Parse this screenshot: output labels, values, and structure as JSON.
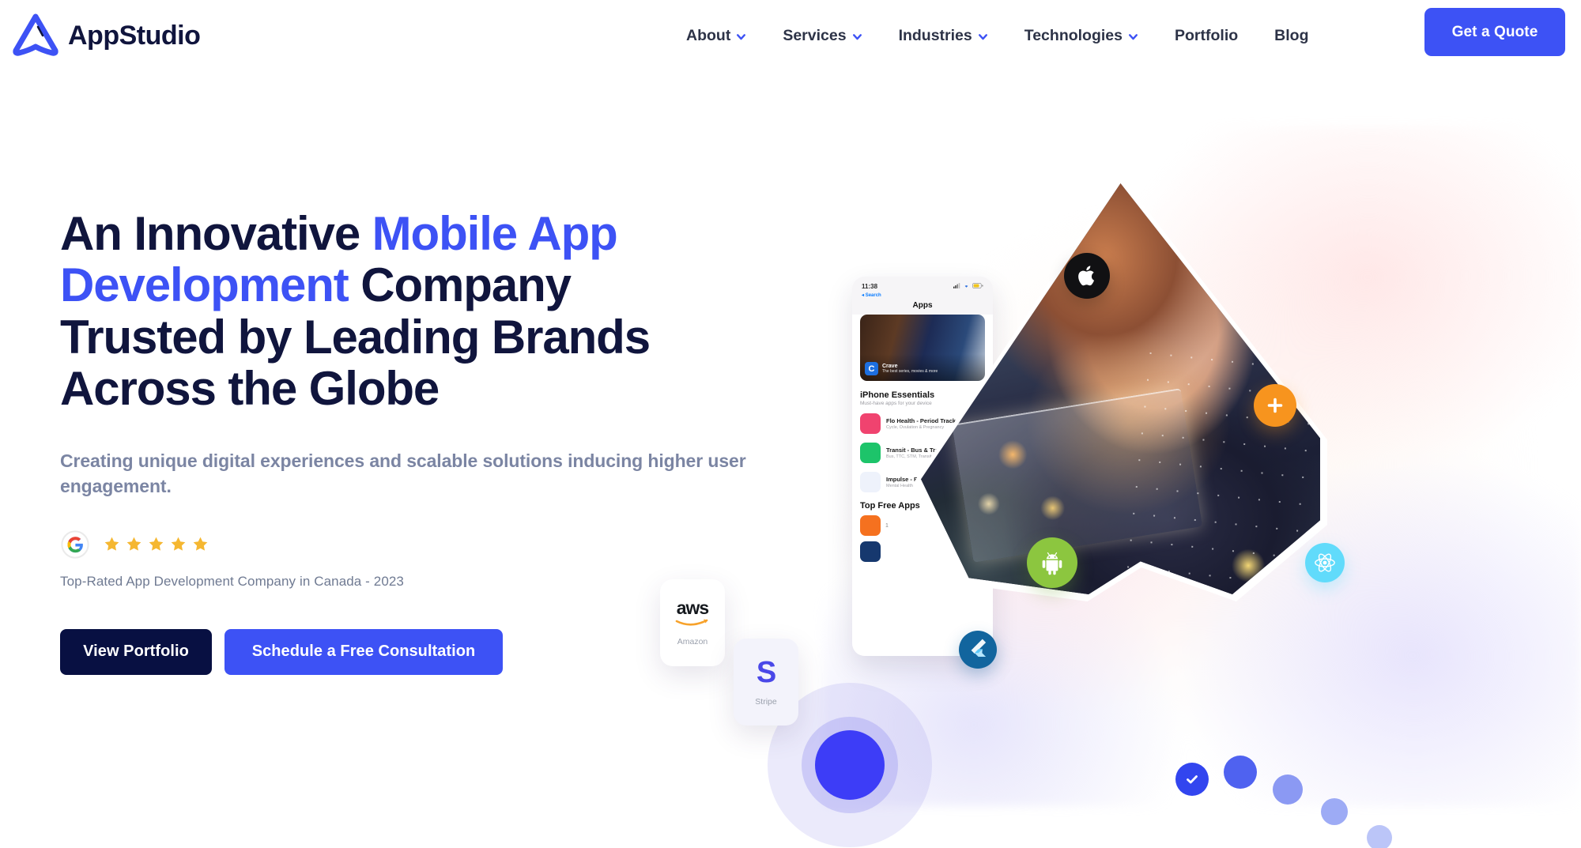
{
  "brand": {
    "name": "AppStudio",
    "logo_icon": "appstudio-triangle-logo",
    "accent_blue": "#3d52f5",
    "dark_navy": "#10153d"
  },
  "nav": {
    "items": [
      {
        "label": "About",
        "has_dropdown": true,
        "caret_icon": "chevron-down-icon"
      },
      {
        "label": "Services",
        "has_dropdown": true,
        "caret_icon": "chevron-down-icon"
      },
      {
        "label": "Industries",
        "has_dropdown": true,
        "caret_icon": "chevron-down-icon"
      },
      {
        "label": "Technologies",
        "has_dropdown": true,
        "caret_icon": "chevron-down-icon"
      },
      {
        "label": "Portfolio",
        "has_dropdown": false
      },
      {
        "label": "Blog",
        "has_dropdown": false
      }
    ],
    "cta_label": "Get a Quote"
  },
  "hero": {
    "headline_parts": [
      {
        "text": "An Innovative ",
        "highlight": false
      },
      {
        "text": "Mobile App Development",
        "highlight": true
      },
      {
        "text": " Company Trusted by Leading Brands Across the Globe",
        "highlight": false
      }
    ],
    "headline_plain": "An Innovative Mobile App Development Company Trusted by Leading Brands Across the Globe",
    "subheadline": "Creating unique digital experiences and scalable solutions inducing higher user engagement.",
    "rating": {
      "provider_icon": "google-g-icon",
      "stars": 5,
      "star_color": "#f5b731",
      "caption": "Top-Rated App Development Company in Canada - 2023"
    },
    "buttons": [
      {
        "label": "View Portfolio",
        "style": "dark"
      },
      {
        "label": "Schedule a Free Consultation",
        "style": "blue"
      }
    ]
  },
  "visual": {
    "phone": {
      "status_time": "11:38",
      "status_location_icon": "location-arrow-icon",
      "back_label": "Search",
      "signal_icon": "cellular-icon",
      "wifi_icon": "wifi-icon",
      "battery_icon": "battery-icon",
      "screen_title": "Apps",
      "featured": {
        "app_initial": "C",
        "app_name": "Crave",
        "app_sub": "The best series, movies & more"
      },
      "section_title": "iPhone Essentials",
      "section_sub": "Must-have apps for your device",
      "apps": [
        {
          "name": "Flo Health - Period Tracker",
          "sub": "Cycle, Ovulation & Pregnancy",
          "color": "#f0436f"
        },
        {
          "name": "Transit - Bus & Train Times",
          "sub": "Bus, TTC, STM, Transit",
          "color": "#1dc46a"
        },
        {
          "name": "Impulse - Brain Training Games",
          "sub": "Mental Health",
          "color": "#eef2fb"
        }
      ],
      "top_free_title": "Top Free Apps",
      "top_free_rank": "1"
    },
    "floating_icons": [
      {
        "name": "apple-icon",
        "label": "Apple",
        "bg": "#111113"
      },
      {
        "name": "android-icon",
        "label": "Android",
        "bg": "#8cc63f"
      },
      {
        "name": "flutter-icon",
        "label": "Flutter",
        "bg": "#12659e"
      },
      {
        "name": "plus-icon",
        "label": "Plus",
        "bg": "#f7941e"
      },
      {
        "name": "react-icon",
        "label": "React",
        "bg": "#61dbfb"
      }
    ],
    "tech_cards": [
      {
        "logo_text": "aws",
        "label": "Amazon",
        "icon": "aws-icon"
      },
      {
        "logo_text": "S",
        "label": "Stripe",
        "icon": "stripe-icon"
      }
    ],
    "check_icon": "check-icon",
    "photo_alt": "Woman using a tablet"
  }
}
